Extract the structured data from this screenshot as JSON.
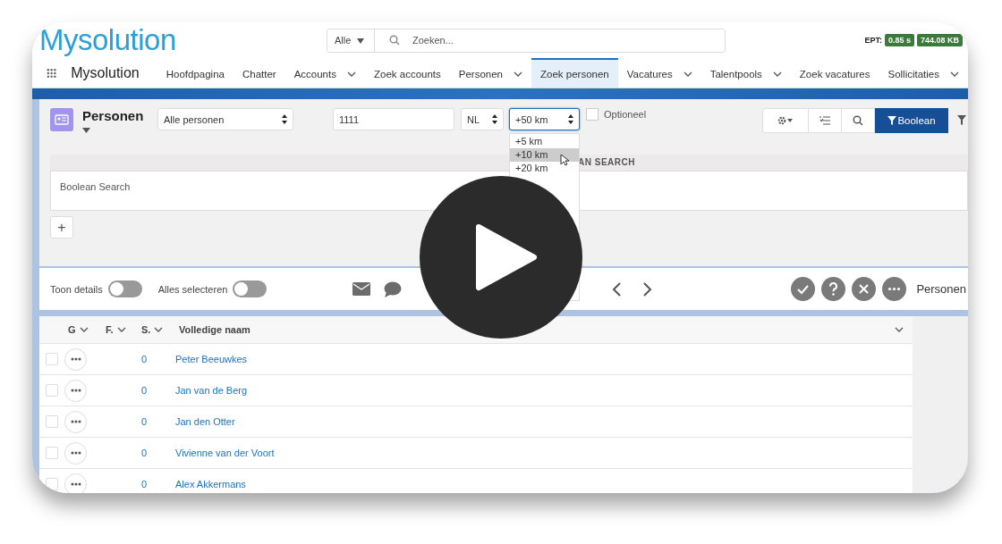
{
  "header": {
    "logo": "Mysolution",
    "search": {
      "scope": "Alle",
      "placeholder": "Zoeken..."
    },
    "ept": {
      "label": "EPT:",
      "badges": [
        "0.85 s",
        "744.08 KB"
      ]
    }
  },
  "nav": {
    "app_name": "Mysolution",
    "tabs": [
      {
        "label": "Hoofdpagina",
        "dropdown": false,
        "selected": false
      },
      {
        "label": "Chatter",
        "dropdown": false,
        "selected": false
      },
      {
        "label": "Accounts",
        "dropdown": true,
        "selected": false
      },
      {
        "label": "Zoek accounts",
        "dropdown": false,
        "selected": false
      },
      {
        "label": "Personen",
        "dropdown": true,
        "selected": false
      },
      {
        "label": "Zoek personen",
        "dropdown": false,
        "selected": true
      },
      {
        "label": "Vacatures",
        "dropdown": true,
        "selected": false
      },
      {
        "label": "Talentpools",
        "dropdown": true,
        "selected": false
      },
      {
        "label": "Zoek vacatures",
        "dropdown": false,
        "selected": false
      },
      {
        "label": "Sollicitaties",
        "dropdown": true,
        "selected": false
      }
    ]
  },
  "search_panel": {
    "title": "Personen",
    "list_view": "Alle personen",
    "postcode": "1111",
    "country": "NL",
    "distance": "+50 km",
    "distance_options": [
      {
        "label": "+5 km",
        "selected": false
      },
      {
        "label": "+10 km",
        "selected": true
      },
      {
        "label": "+20 km",
        "selected": false
      }
    ],
    "optional": {
      "label": "Optioneel",
      "checked": false
    },
    "primary_button": "Boolean",
    "section_label": "AN SEARCH",
    "boolean_placeholder": "Boolean Search",
    "add_button": "+"
  },
  "toolbar": {
    "toggles": [
      {
        "label": "Toon details",
        "on": false
      },
      {
        "label": "Alles selecteren",
        "on": false
      }
    ],
    "object_label": "Personen"
  },
  "table": {
    "columns": [
      "G",
      "F.",
      "S.",
      "Volledige naam"
    ],
    "rows": [
      {
        "s": "0",
        "name": "Peter Beeuwkes",
        "checked": false
      },
      {
        "s": "0",
        "name": "Jan van de Berg",
        "checked": false
      },
      {
        "s": "0",
        "name": "Jan den Otter",
        "checked": false
      },
      {
        "s": "0",
        "name": "Vivienne van der Voort",
        "checked": false
      },
      {
        "s": "0",
        "name": "Alex Akkermans",
        "checked": false
      }
    ]
  }
}
